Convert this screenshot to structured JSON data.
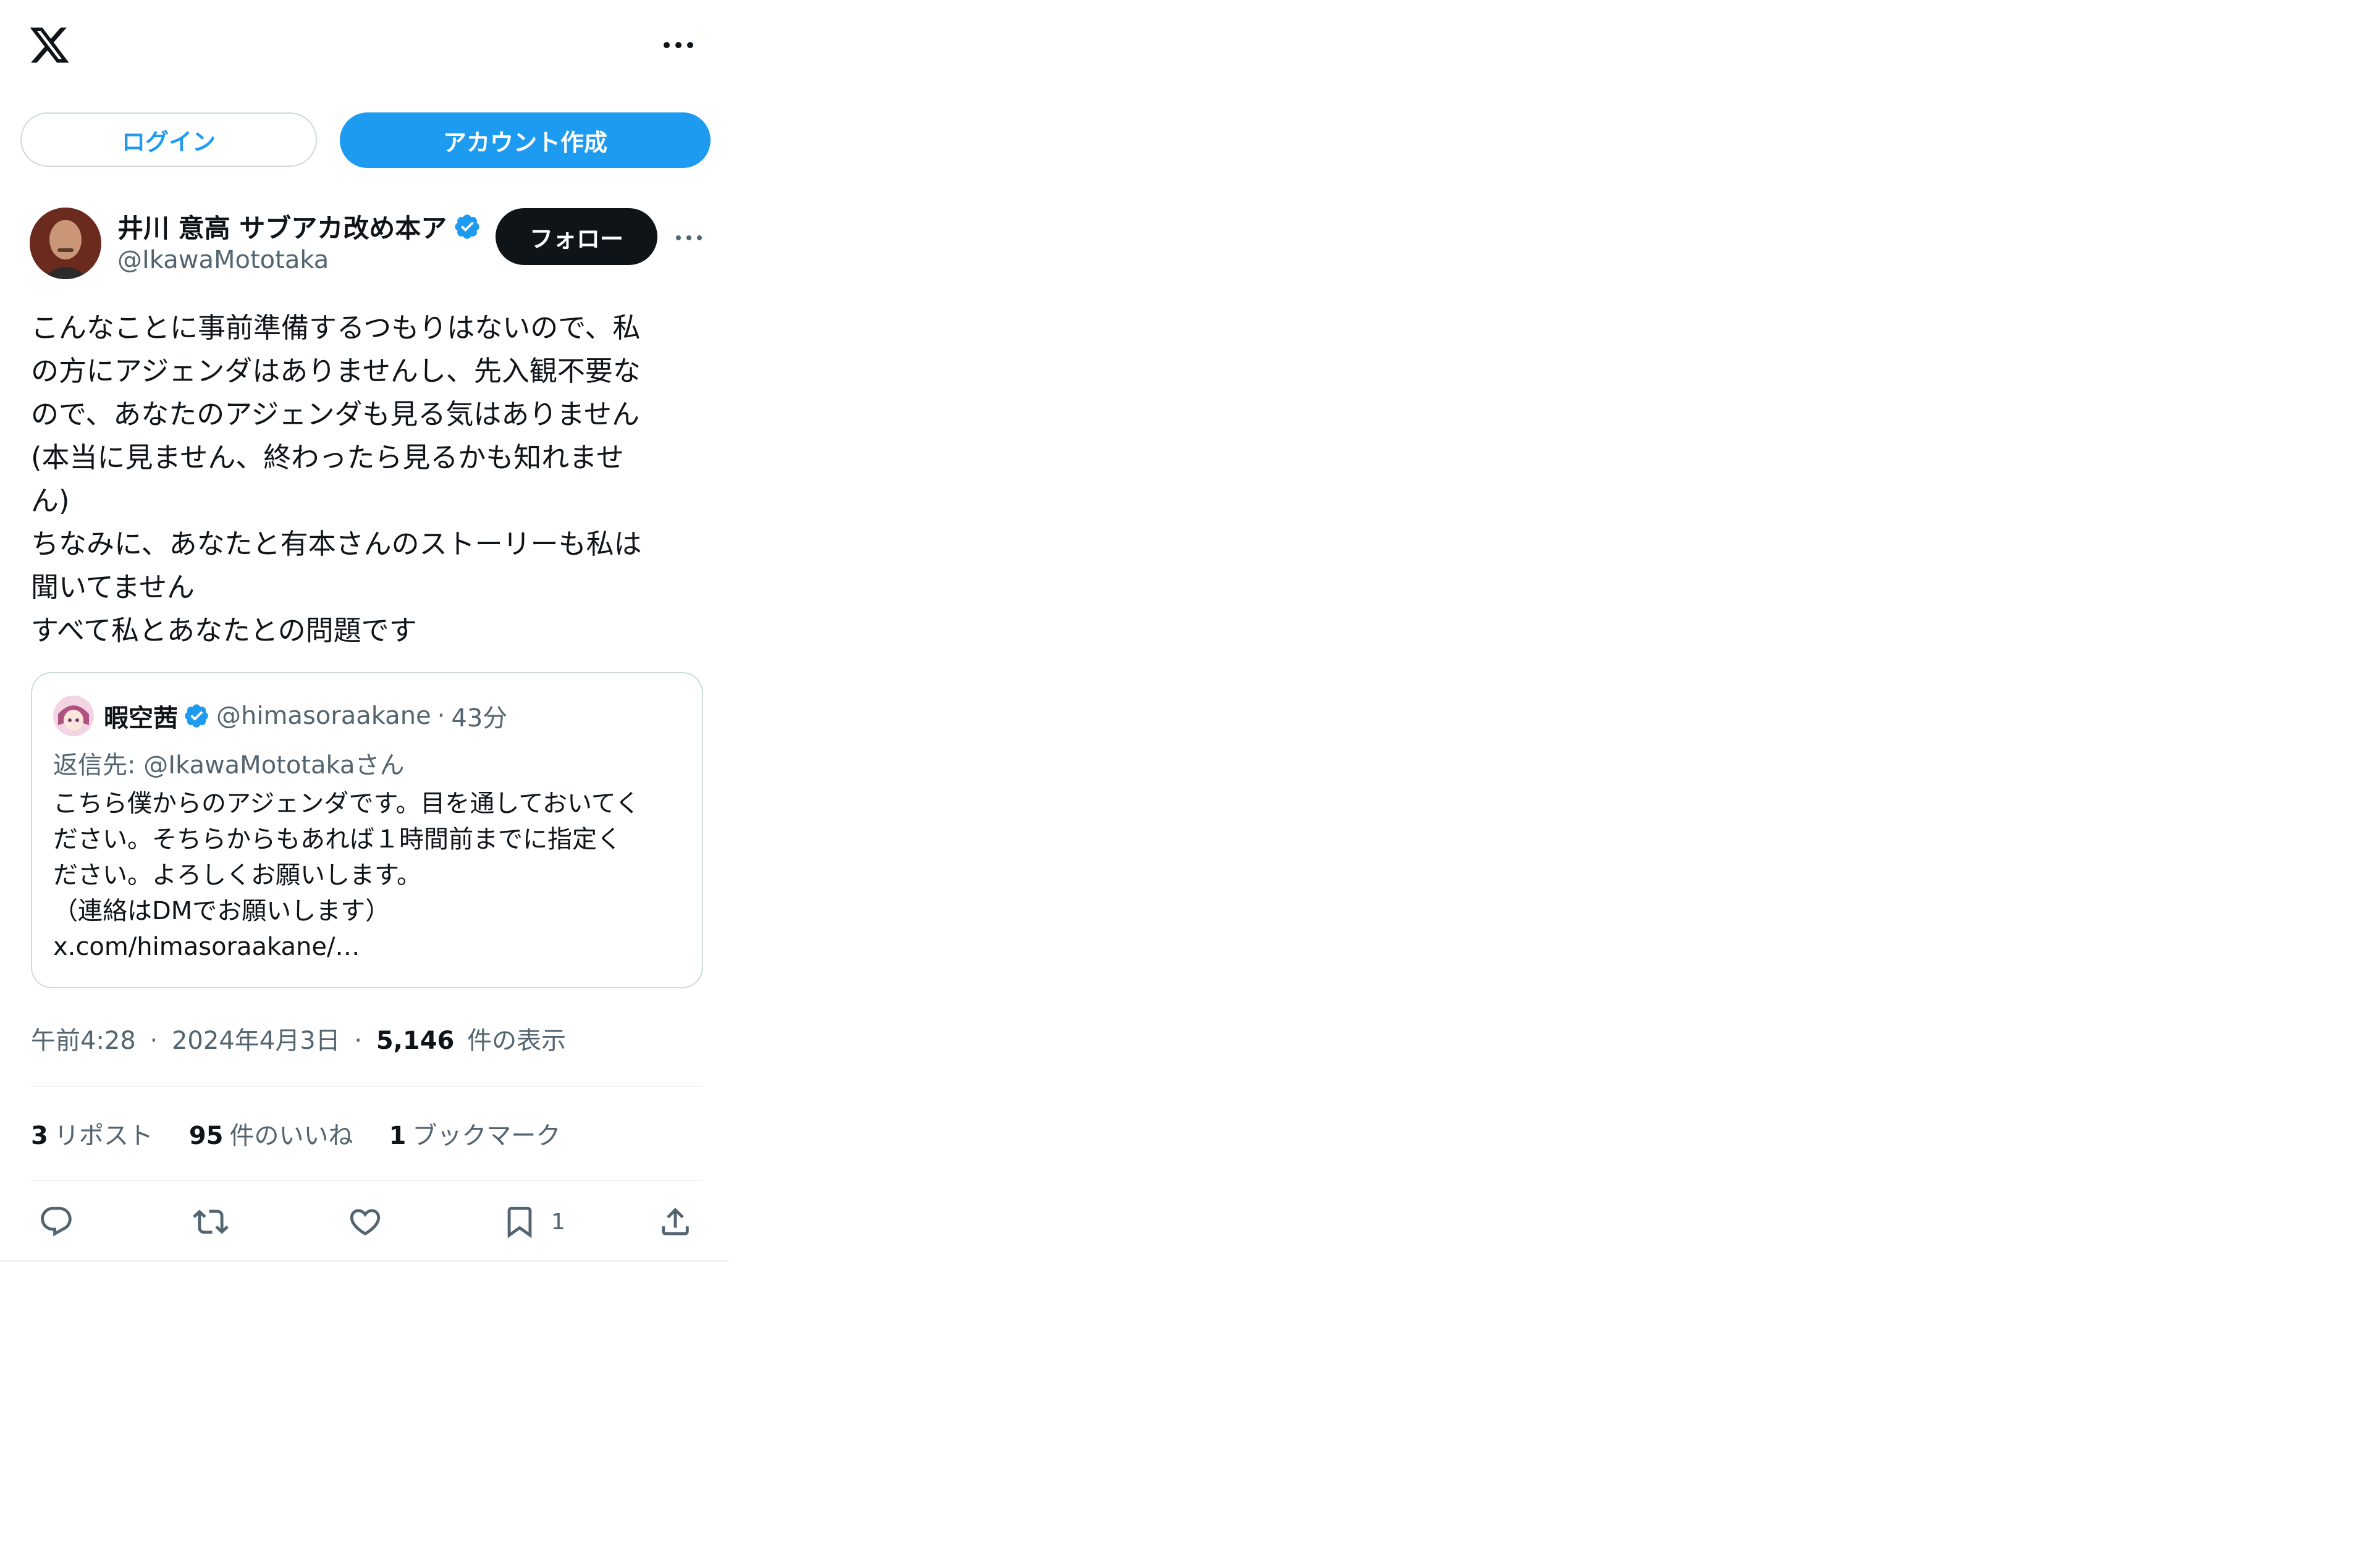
{
  "topbar": {
    "logo": "x-logo-icon",
    "more": "more-horizontal-icon"
  },
  "auth": {
    "login_label": "ログイン",
    "signup_label": "アカウント作成"
  },
  "author": {
    "name": "井川 意高 サブアカ改め本ア",
    "handle": "@IkawaMototaka",
    "follow_label": "フォロー"
  },
  "tweet": {
    "text": "こんなことに事前準備するつもりはないので、私\nの方にアジェンダはありませんし、先入観不要な\nので、あなたのアジェンダも見る気はありません\n(本当に見ません、終わったら見るかも知れませ\nん)\nちなみに、あなたと有本さんのストーリーも私は\n聞いてません\nすべて私とあなたとの問題です"
  },
  "quote": {
    "name": "暇空茜",
    "handle": "@himasoraakane",
    "dot": "·",
    "time": "43分",
    "reply_to": "返信先: @IkawaMototakaさん",
    "text": "こちら僕からのアジェンダです。目を通しておいてく\nださい。そちらからもあれば１時間前までに指定く\nださい。よろしくお願いします。\n（連絡はDMでお願いします）\nx.com/himasoraakane/…"
  },
  "meta": {
    "time": "午前4:28",
    "sep1": "·",
    "date": "2024年4月3日",
    "sep2": "·",
    "views_count": "5,146",
    "views_label": "件の表示"
  },
  "stats": {
    "reposts_count": "3",
    "reposts_label": "リポスト",
    "likes_count": "95",
    "likes_label": "件のいいね",
    "bookmarks_count": "1",
    "bookmarks_label": "ブックマーク"
  },
  "actions": {
    "icons": [
      "reply-icon",
      "repost-icon",
      "like-icon",
      "bookmark-icon",
      "share-icon"
    ],
    "bookmark_count": "1"
  },
  "colors": {
    "accent": "#1d9bf0",
    "text": "#0f1419",
    "secondary": "#536471",
    "border": "#cfd9de"
  }
}
